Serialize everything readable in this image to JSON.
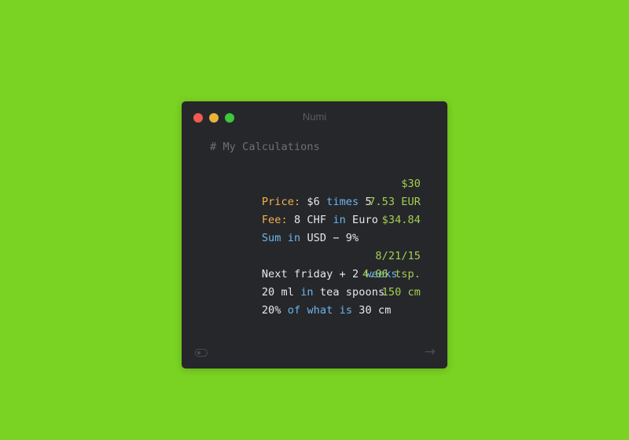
{
  "window": {
    "title": "Numi"
  },
  "editor": {
    "comment": "# My Calculations",
    "lines": [
      {
        "tokens": [
          {
            "t": "Price:",
            "k": "label"
          },
          {
            "t": " $6 ",
            "k": "text"
          },
          {
            "t": "times",
            "k": "kw"
          },
          {
            "t": " 5",
            "k": "text"
          }
        ],
        "result": "$30"
      },
      {
        "tokens": [
          {
            "t": "Fee:",
            "k": "label"
          },
          {
            "t": " 8 CHF ",
            "k": "text"
          },
          {
            "t": "in",
            "k": "kw"
          },
          {
            "t": " Euro",
            "k": "text"
          }
        ],
        "result": "7.53 EUR"
      },
      {
        "tokens": [
          {
            "t": "Sum",
            "k": "kw"
          },
          {
            "t": " ",
            "k": "text"
          },
          {
            "t": "in",
            "k": "kw"
          },
          {
            "t": " USD − 9%",
            "k": "text"
          }
        ],
        "result": "$34.84"
      },
      {
        "tokens": [
          {
            "t": "Next friday + 2 ",
            "k": "text"
          },
          {
            "t": "weeks",
            "k": "kw"
          }
        ],
        "result": "8/21/15"
      },
      {
        "tokens": [
          {
            "t": "20 ml ",
            "k": "text"
          },
          {
            "t": "in",
            "k": "kw"
          },
          {
            "t": " tea spoons",
            "k": "text"
          }
        ],
        "result": "4.06 tsp."
      },
      {
        "tokens": [
          {
            "t": "20% ",
            "k": "text"
          },
          {
            "t": "of",
            "k": "kw"
          },
          {
            "t": " ",
            "k": "text"
          },
          {
            "t": "what",
            "k": "kw"
          },
          {
            "t": " ",
            "k": "text"
          },
          {
            "t": "is",
            "k": "kw"
          },
          {
            "t": " 30 cm",
            "k": "text"
          }
        ],
        "result": "150 cm"
      }
    ]
  },
  "footer": {
    "left_icon": "toggle-icon",
    "right_icon": "arrow-right-icon",
    "right_glyph": "→"
  },
  "colors": {
    "background": "#7ad322",
    "window": "#26272b",
    "label": "#f2b14c",
    "keyword": "#6cb6ea",
    "result": "#a3d04e",
    "comment": "#6f7075"
  }
}
